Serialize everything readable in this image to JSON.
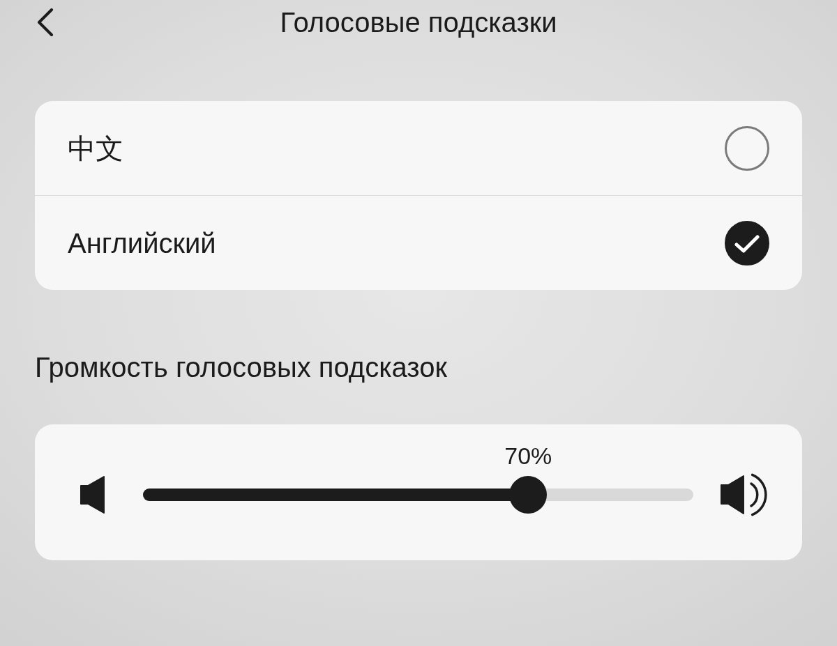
{
  "header": {
    "title": "Голосовые подсказки"
  },
  "languages": [
    {
      "label": "中文",
      "selected": false
    },
    {
      "label": "Английский",
      "selected": true
    }
  ],
  "volume": {
    "heading": "Громкость голосовых подсказок",
    "reading": "70%",
    "level": 0.7
  }
}
